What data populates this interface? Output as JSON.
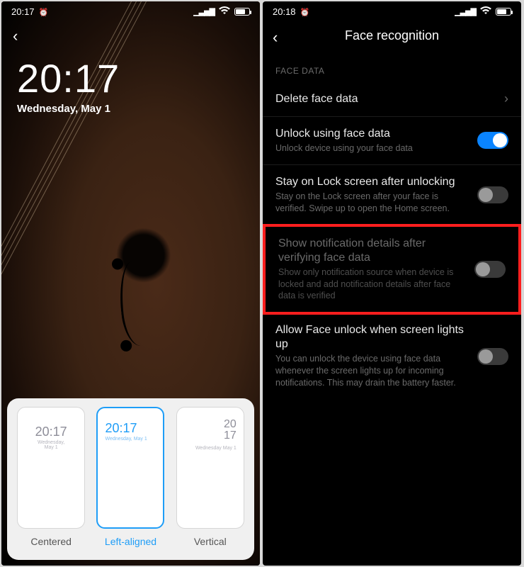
{
  "left": {
    "status": {
      "time": "20:17"
    },
    "clock": {
      "time": "20:17",
      "date": "Wednesday, May 1"
    },
    "chooser": {
      "options": [
        {
          "label": "Centered",
          "thumbTime": "20:17",
          "thumbDate": "Wednesday, May 1"
        },
        {
          "label": "Left-aligned",
          "thumbTime": "20:17",
          "thumbDate": "Wednesday, May 1"
        },
        {
          "label": "Vertical",
          "thumbTimeTop": "20",
          "thumbTimeBottom": "17",
          "thumbDate": "Wednesday May 1"
        }
      ],
      "selectedIndex": 1
    }
  },
  "right": {
    "status": {
      "time": "20:18"
    },
    "header": {
      "title": "Face recognition"
    },
    "sectionTitle": "FACE DATA",
    "rows": {
      "delete": {
        "title": "Delete face data"
      },
      "unlock": {
        "title": "Unlock using face data",
        "sub": "Unlock device using your face data",
        "on": true
      },
      "stay": {
        "title": "Stay on Lock screen after unlocking",
        "sub": "Stay on the Lock screen after your face is verified. Swipe up to open the Home screen.",
        "on": false
      },
      "notifDetails": {
        "title": "Show notification details after verifying face data",
        "sub": "Show only notification source when device is locked and add notification details after face data is verified",
        "on": false
      },
      "allowLightUp": {
        "title": "Allow Face unlock when screen lights up",
        "sub": "You can unlock the device using face data whenever the screen lights up for incoming notifications. This may drain the battery faster.",
        "on": false
      }
    }
  }
}
